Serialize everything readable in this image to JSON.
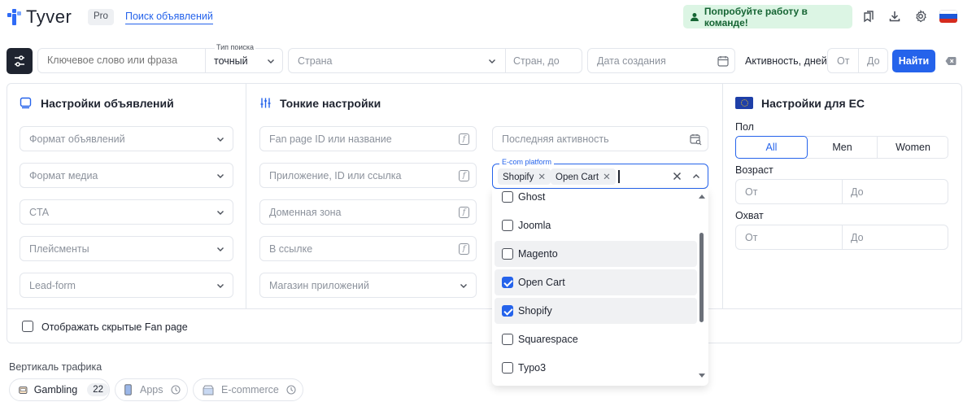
{
  "header": {
    "logo": "Tyver",
    "plan_badge": "Pro",
    "nav_link": "Поиск объявлений",
    "team_button": "Попробуйте работу в команде!",
    "icons": [
      "bookmarks-icon",
      "download-icon",
      "settings-gear-icon",
      "russia-flag-icon"
    ]
  },
  "search": {
    "keyword_placeholder": "Ключевое слово или фраза",
    "search_type_label": "Тип поиска",
    "search_type_value": "точный",
    "country_placeholder": "Страна",
    "countries_to_placeholder": "Стран, до",
    "date_placeholder": "Дата создания",
    "activity_label": "Активность, дней",
    "activity_from": "От",
    "activity_to": "До",
    "find_button": "Найти"
  },
  "ad_settings": {
    "title": "Настройки объявлений",
    "fields": [
      "Формат объявлений",
      "Формат медиа",
      "CTA",
      "Плейсменты",
      "Lead-form"
    ]
  },
  "fine_settings": {
    "title": "Тонкие настройки",
    "fields": [
      "Fan page ID или название",
      "Приложение, ID или ссылка",
      "Доменная зона",
      "В ссылке",
      "Магазин приложений"
    ],
    "last_activity_placeholder": "Последняя активность",
    "ecom_label": "E-com platform",
    "ecom_chips": [
      "Shopify",
      "Open Cart"
    ],
    "dropdown_options": [
      {
        "label": "Ghost",
        "checked": false
      },
      {
        "label": "Joomla",
        "checked": false
      },
      {
        "label": "Magento",
        "checked": false
      },
      {
        "label": "Open Cart",
        "checked": true
      },
      {
        "label": "Shopify",
        "checked": true
      },
      {
        "label": "Squarespace",
        "checked": false
      },
      {
        "label": "Typo3",
        "checked": false
      }
    ]
  },
  "eu_settings": {
    "title": "Настройки для ЕС",
    "gender_label": "Пол",
    "gender_options": [
      "All",
      "Men",
      "Women"
    ],
    "gender_selected": "All",
    "age_label": "Возраст",
    "age_from": "От",
    "age_to": "До",
    "reach_label": "Охват",
    "reach_from": "От",
    "reach_to": "До"
  },
  "hidden_fanpage_label": "Отображать скрытые Fan page",
  "traffic": {
    "label": "Вертикаль трафика",
    "items": [
      {
        "label": "Gambling",
        "count": "22"
      },
      {
        "label": "Apps"
      },
      {
        "label": "E-commerce"
      }
    ]
  },
  "colors": {
    "accent": "#2563eb",
    "team_bg": "#dcf5e4",
    "team_text": "#166534"
  }
}
